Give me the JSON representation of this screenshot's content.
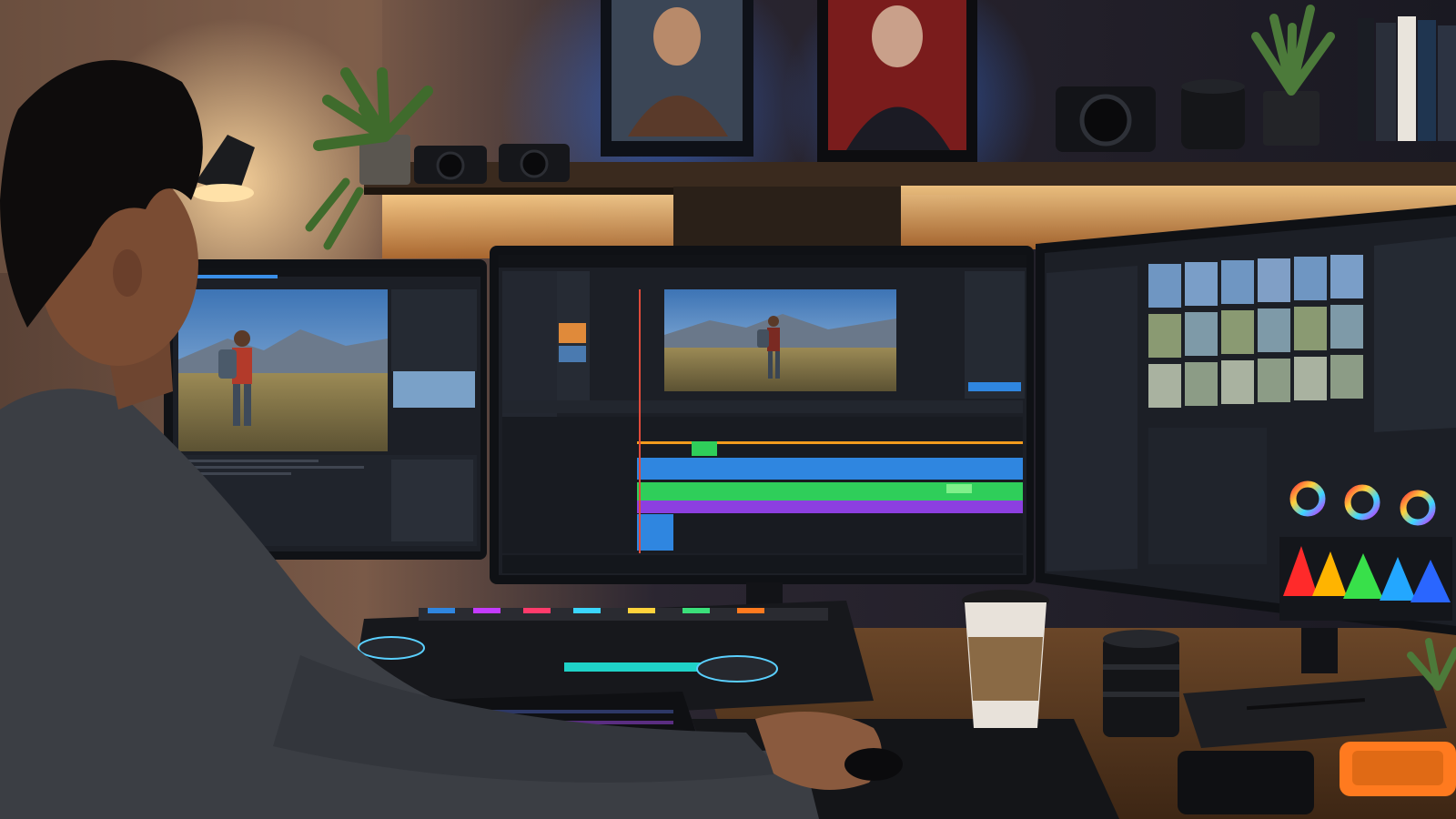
{
  "scene": {
    "title": "",
    "colors": {
      "wall_left": "#6b4e3d",
      "wall_dark": "#1f1a1e",
      "shelf_light": "#f4b56a",
      "shelf_wood": "#3a2a1e",
      "monitor_bezel": "#101216",
      "ui_bg": "#1c1f26",
      "ui_panel": "#252a33",
      "sky": "#5f94c9",
      "ground": "#8a7a4e",
      "track_orange": "#f29b1d",
      "track_blue": "#2f86e0",
      "track_green": "#2fce5a",
      "track_purple": "#8c3fe0",
      "desk": "#5a3b24",
      "cup": "#e8e2da",
      "cup_sleeve": "#8a6a45",
      "drive_orange": "#ff7a1f",
      "shirt": "#3b3e44"
    },
    "monitors": [
      {
        "name": "left",
        "brand": ""
      },
      {
        "name": "center",
        "brand": ""
      },
      {
        "name": "right",
        "brand": ""
      }
    ],
    "timeline_tracks": [
      "video",
      "audio-blue",
      "audio-green",
      "audio-purple"
    ],
    "color_wheels": 3,
    "histogram_colors": [
      "#ff2a2a",
      "#ffb400",
      "#38e04a",
      "#23a7ff",
      "#2a66ff"
    ],
    "thumbnail_rows": 3,
    "thumbnail_cols": 6,
    "icons": [
      "desk-lamp-icon",
      "plant-icon",
      "camera-icon",
      "coffee-cup-icon",
      "lens-icon",
      "hard-drive-icon",
      "keyboard-icon",
      "mouse-icon"
    ]
  }
}
